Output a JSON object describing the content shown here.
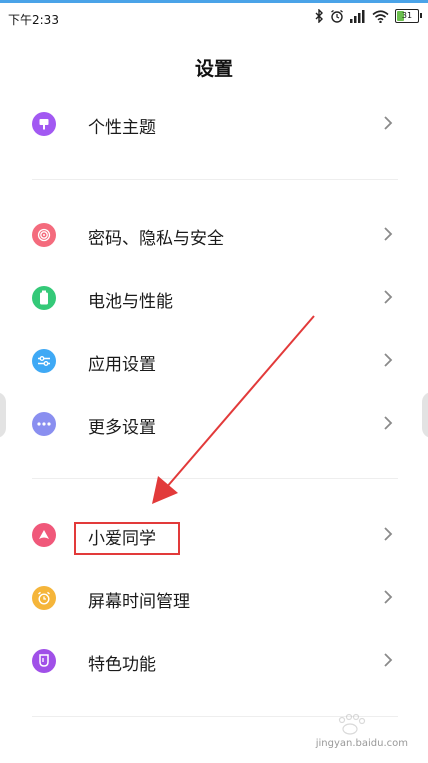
{
  "status_bar": {
    "time": "下午2:33",
    "battery_level": "31"
  },
  "page_title": "设置",
  "settings": [
    {
      "id": "theme",
      "label": "个性主题",
      "icon": "theme-brush-icon",
      "color": "#a259f2"
    },
    {
      "id": "password-privacy",
      "label": "密码、隐私与安全",
      "icon": "fingerprint-icon",
      "color": "#f46b7d"
    },
    {
      "id": "battery",
      "label": "电池与性能",
      "icon": "battery-icon",
      "color": "#34c978"
    },
    {
      "id": "app-settings",
      "label": "应用设置",
      "icon": "sliders-icon",
      "color": "#3fa9f5"
    },
    {
      "id": "more-settings",
      "label": "更多设置",
      "icon": "more-dots-icon",
      "color": "#8a8ff0"
    },
    {
      "id": "xiaoai",
      "label": "小爱同学",
      "icon": "xiaoai-icon",
      "color": "#f0587a"
    },
    {
      "id": "screen-time",
      "label": "屏幕时间管理",
      "icon": "alarm-clock-icon",
      "color": "#f5b53a"
    },
    {
      "id": "special-features",
      "label": "特色功能",
      "icon": "feature-cup-icon",
      "color": "#a050e8"
    }
  ],
  "watermark": {
    "text": "jingyan.baidu.com"
  }
}
